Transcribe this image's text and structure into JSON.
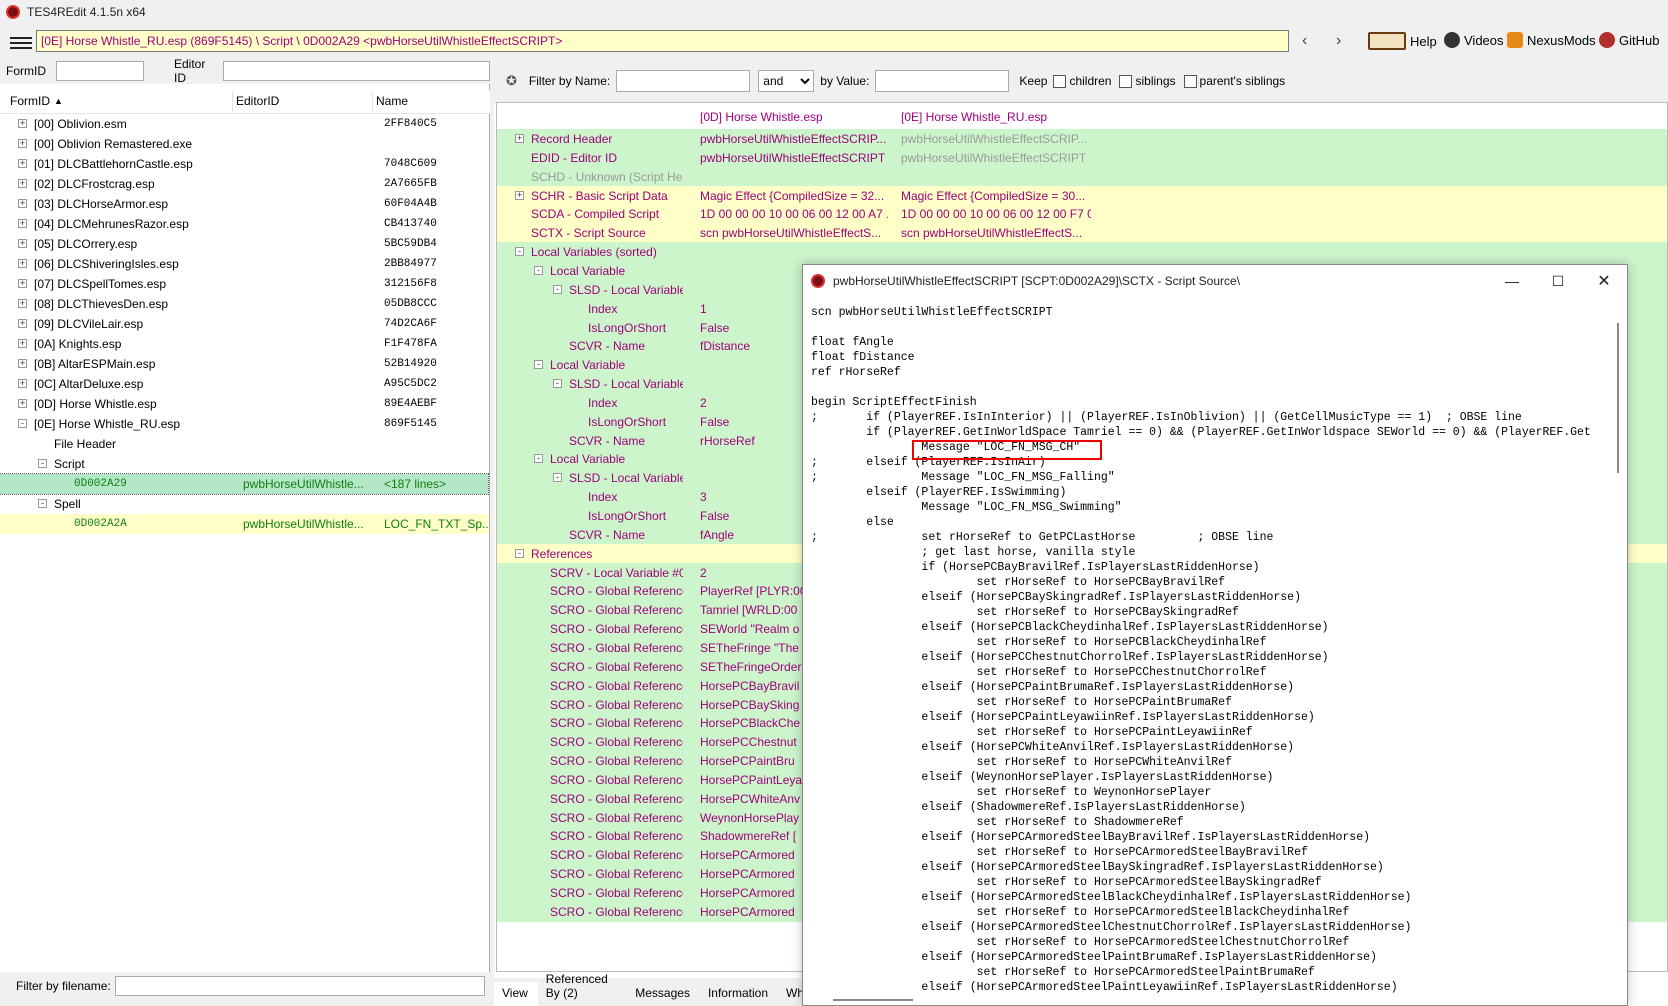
{
  "app": {
    "title": "TES4REdit 4.1.5n x64"
  },
  "path_bar": "[0E] Horse Whistle_RU.esp (869F5145) \\ Script \\ 0D002A29 <pwbHorseUtilWhistleEffectSCRIPT>",
  "top_links": [
    "Help",
    "Videos",
    "NexusMods",
    "GitHub"
  ],
  "left": {
    "formid_label": "FormID",
    "editorid_label": "Editor ID",
    "columns": [
      "FormID",
      "EditorID",
      "Name"
    ],
    "rows": [
      {
        "label": "[00] Oblivion.esm",
        "editor": "",
        "name": "2FF840C5",
        "level": 0,
        "expander": "+",
        "style": ""
      },
      {
        "label": "[00] Oblivion Remastered.exe",
        "editor": "",
        "name": "",
        "level": 0,
        "expander": "+",
        "style": ""
      },
      {
        "label": "[01] DLCBattlehornCastle.esp",
        "editor": "",
        "name": "7048C609",
        "level": 0,
        "expander": "+",
        "style": ""
      },
      {
        "label": "[02] DLCFrostcrag.esp",
        "editor": "",
        "name": "2A7665FB",
        "level": 0,
        "expander": "+",
        "style": ""
      },
      {
        "label": "[03] DLCHorseArmor.esp",
        "editor": "",
        "name": "60F04A4B",
        "level": 0,
        "expander": "+",
        "style": ""
      },
      {
        "label": "[04] DLCMehrunesRazor.esp",
        "editor": "",
        "name": "CB413740",
        "level": 0,
        "expander": "+",
        "style": ""
      },
      {
        "label": "[05] DLCOrrery.esp",
        "editor": "",
        "name": "5BC59DB4",
        "level": 0,
        "expander": "+",
        "style": ""
      },
      {
        "label": "[06] DLCShiveringIsles.esp",
        "editor": "",
        "name": "2BB84977",
        "level": 0,
        "expander": "+",
        "style": ""
      },
      {
        "label": "[07] DLCSpellTomes.esp",
        "editor": "",
        "name": "312156F8",
        "level": 0,
        "expander": "+",
        "style": ""
      },
      {
        "label": "[08] DLCThievesDen.esp",
        "editor": "",
        "name": "05DB8CCC",
        "level": 0,
        "expander": "+",
        "style": ""
      },
      {
        "label": "[09] DLCVileLair.esp",
        "editor": "",
        "name": "74D2CA6F",
        "level": 0,
        "expander": "+",
        "style": ""
      },
      {
        "label": "[0A] Knights.esp",
        "editor": "",
        "name": "F1F478FA",
        "level": 0,
        "expander": "+",
        "style": ""
      },
      {
        "label": "[0B] AltarESPMain.esp",
        "editor": "",
        "name": "52B14920",
        "level": 0,
        "expander": "+",
        "style": ""
      },
      {
        "label": "[0C] AltarDeluxe.esp",
        "editor": "",
        "name": "A95C5DC2",
        "level": 0,
        "expander": "+",
        "style": ""
      },
      {
        "label": "[0D] Horse Whistle.esp",
        "editor": "",
        "name": "89E4AEBF",
        "level": 0,
        "expander": "+",
        "style": ""
      },
      {
        "label": "[0E] Horse Whistle_RU.esp",
        "editor": "",
        "name": "869F5145",
        "level": 0,
        "expander": "-",
        "style": ""
      },
      {
        "label": "File Header",
        "editor": "",
        "name": "",
        "level": 1,
        "expander": "",
        "style": ""
      },
      {
        "label": "Script",
        "editor": "",
        "name": "",
        "level": 1,
        "expander": "-",
        "style": ""
      },
      {
        "label": "0D002A29",
        "editor": "pwbHorseUtilWhistle...",
        "name": "<187 lines>",
        "level": 2,
        "expander": "",
        "style": "selected"
      },
      {
        "label": "Spell",
        "editor": "",
        "name": "",
        "level": 1,
        "expander": "-",
        "style": ""
      },
      {
        "label": "0D002A2A",
        "editor": "pwbHorseUtilWhistle...",
        "name": "LOC_FN_TXT_Sp...",
        "level": 2,
        "expander": "",
        "style": "yellow"
      }
    ],
    "filter_label": "Filter by filename:"
  },
  "filterbar": {
    "filter_by_name": "Filter by Name:",
    "and_value": "and",
    "by_value": "by Value:",
    "keep": "Keep",
    "children": "children",
    "siblings": "siblings",
    "parents_siblings": "parent's siblings"
  },
  "grid": {
    "col_headers": [
      "[0D] Horse Whistle.esp",
      "[0E] Horse Whistle_RU.esp"
    ],
    "rows": [
      {
        "name": "Record Header",
        "v1": "pwbHorseUtilWhistleEffectSCRIP...",
        "v2": "pwbHorseUtilWhistleEffectSCRIP...",
        "indent": 0,
        "exp": "+",
        "bg": "green",
        "c1": "purple",
        "c2": "grey"
      },
      {
        "name": "EDID - Editor ID",
        "v1": "pwbHorseUtilWhistleEffectSCRIPT",
        "v2": "pwbHorseUtilWhistleEffectSCRIPT",
        "indent": 0,
        "exp": "",
        "bg": "green",
        "c1": "purple",
        "c2": "grey"
      },
      {
        "name": "SCHD - Unknown (Script He...",
        "v1": "",
        "v2": "",
        "indent": 0,
        "exp": "",
        "bg": "green",
        "c1": "grey",
        "c2": "grey"
      },
      {
        "name": "SCHR - Basic Script Data",
        "v1": "Magic Effect {CompiledSize = 32...",
        "v2": "Magic Effect {CompiledSize = 30...",
        "indent": 0,
        "exp": "+",
        "bg": "yellow",
        "c1": "purple",
        "c2": "purple"
      },
      {
        "name": "SCDA - Compiled Script",
        "v1": "1D 00 00 00 10 00 06 00 12 00 A7 ...",
        "v2": "1D 00 00 00 10 00 06 00 12 00 F7 0...",
        "indent": 0,
        "exp": "",
        "bg": "yellow",
        "c1": "purple",
        "c2": "purple"
      },
      {
        "name": "SCTX - Script Source",
        "v1": "scn pwbHorseUtilWhistleEffectS...",
        "v2": "scn pwbHorseUtilWhistleEffectS...",
        "indent": 0,
        "exp": "",
        "bg": "yellow",
        "c1": "purple",
        "c2": "purple"
      },
      {
        "name": "Local Variables (sorted)",
        "v1": "",
        "v2": "",
        "indent": 0,
        "exp": "-",
        "bg": "green",
        "c1": "purple",
        "c2": "purple"
      },
      {
        "name": "Local Variable",
        "v1": "",
        "v2": "",
        "indent": 1,
        "exp": "-",
        "bg": "green",
        "c1": "purple",
        "c2": "purple"
      },
      {
        "name": "SLSD - Local Variable ...",
        "v1": "",
        "v2": "",
        "indent": 2,
        "exp": "-",
        "bg": "green",
        "c1": "purple",
        "c2": "purple"
      },
      {
        "name": "Index",
        "v1": "1",
        "v2": "",
        "indent": 3,
        "exp": "",
        "bg": "green",
        "c1": "purple",
        "c2": "purple"
      },
      {
        "name": "IsLongOrShort",
        "v1": "False",
        "v2": "",
        "indent": 3,
        "exp": "",
        "bg": "green",
        "c1": "purple",
        "c2": "purple"
      },
      {
        "name": "SCVR - Name",
        "v1": "fDistance",
        "v2": "",
        "indent": 2,
        "exp": "",
        "bg": "green",
        "c1": "purple",
        "c2": "purple"
      },
      {
        "name": "Local Variable",
        "v1": "",
        "v2": "",
        "indent": 1,
        "exp": "-",
        "bg": "green",
        "c1": "purple",
        "c2": "purple"
      },
      {
        "name": "SLSD - Local Variable ...",
        "v1": "",
        "v2": "",
        "indent": 2,
        "exp": "-",
        "bg": "green",
        "c1": "purple",
        "c2": "purple"
      },
      {
        "name": "Index",
        "v1": "2",
        "v2": "",
        "indent": 3,
        "exp": "",
        "bg": "green",
        "c1": "purple",
        "c2": "purple"
      },
      {
        "name": "IsLongOrShort",
        "v1": "False",
        "v2": "",
        "indent": 3,
        "exp": "",
        "bg": "green",
        "c1": "purple",
        "c2": "purple"
      },
      {
        "name": "SCVR - Name",
        "v1": "rHorseRef",
        "v2": "",
        "indent": 2,
        "exp": "",
        "bg": "green",
        "c1": "purple",
        "c2": "purple"
      },
      {
        "name": "Local Variable",
        "v1": "",
        "v2": "",
        "indent": 1,
        "exp": "-",
        "bg": "green",
        "c1": "purple",
        "c2": "purple"
      },
      {
        "name": "SLSD - Local Variable ...",
        "v1": "",
        "v2": "",
        "indent": 2,
        "exp": "-",
        "bg": "green",
        "c1": "purple",
        "c2": "purple"
      },
      {
        "name": "Index",
        "v1": "3",
        "v2": "",
        "indent": 3,
        "exp": "",
        "bg": "green",
        "c1": "purple",
        "c2": "purple"
      },
      {
        "name": "IsLongOrShort",
        "v1": "False",
        "v2": "",
        "indent": 3,
        "exp": "",
        "bg": "green",
        "c1": "purple",
        "c2": "purple"
      },
      {
        "name": "SCVR - Name",
        "v1": "fAngle",
        "v2": "",
        "indent": 2,
        "exp": "",
        "bg": "green",
        "c1": "purple",
        "c2": "purple"
      },
      {
        "name": "References",
        "v1": "",
        "v2": "",
        "indent": 0,
        "exp": "-",
        "bg": "yellow",
        "c1": "purple",
        "c2": "purple"
      },
      {
        "name": "SCRV - Local Variable #0",
        "v1": "2",
        "v2": "",
        "indent": 1,
        "exp": "",
        "bg": "green",
        "c1": "purple",
        "c2": "purple"
      },
      {
        "name": "SCRO - Global Reference ...",
        "v1": "PlayerRef [PLYR:00",
        "v2": "",
        "indent": 1,
        "exp": "",
        "bg": "green",
        "c1": "purple",
        "c2": "purple"
      },
      {
        "name": "SCRO - Global Reference ...",
        "v1": "Tamriel [WRLD:00",
        "v2": "",
        "indent": 1,
        "exp": "",
        "bg": "green",
        "c1": "purple",
        "c2": "purple"
      },
      {
        "name": "SCRO - Global Reference ...",
        "v1": "SEWorld \"Realm o",
        "v2": "",
        "indent": 1,
        "exp": "",
        "bg": "green",
        "c1": "purple",
        "c2": "purple"
      },
      {
        "name": "SCRO - Global Reference ...",
        "v1": "SETheFringe \"The",
        "v2": "",
        "indent": 1,
        "exp": "",
        "bg": "green",
        "c1": "purple",
        "c2": "purple"
      },
      {
        "name": "SCRO - Global Reference ...",
        "v1": "SETheFringeOrder",
        "v2": "",
        "indent": 1,
        "exp": "",
        "bg": "green",
        "c1": "purple",
        "c2": "purple"
      },
      {
        "name": "SCRO - Global Reference ...",
        "v1": "HorsePCBayBravil",
        "v2": "",
        "indent": 1,
        "exp": "",
        "bg": "green",
        "c1": "purple",
        "c2": "purple"
      },
      {
        "name": "SCRO - Global Reference ...",
        "v1": "HorsePCBaySking",
        "v2": "",
        "indent": 1,
        "exp": "",
        "bg": "green",
        "c1": "purple",
        "c2": "purple"
      },
      {
        "name": "SCRO - Global Reference ...",
        "v1": "HorsePCBlackChe",
        "v2": "",
        "indent": 1,
        "exp": "",
        "bg": "green",
        "c1": "purple",
        "c2": "purple"
      },
      {
        "name": "SCRO - Global Reference ...",
        "v1": "HorsePCChestnut",
        "v2": "",
        "indent": 1,
        "exp": "",
        "bg": "green",
        "c1": "purple",
        "c2": "purple"
      },
      {
        "name": "SCRO - Global Reference ...",
        "v1": "HorsePCPaintBru",
        "v2": "",
        "indent": 1,
        "exp": "",
        "bg": "green",
        "c1": "purple",
        "c2": "purple"
      },
      {
        "name": "SCRO - Global Reference ...",
        "v1": "HorsePCPaintLeya",
        "v2": "",
        "indent": 1,
        "exp": "",
        "bg": "green",
        "c1": "purple",
        "c2": "purple"
      },
      {
        "name": "SCRO - Global Reference ...",
        "v1": "HorsePCWhiteAnv",
        "v2": "",
        "indent": 1,
        "exp": "",
        "bg": "green",
        "c1": "purple",
        "c2": "purple"
      },
      {
        "name": "SCRO - Global Reference ...",
        "v1": "WeynonHorsePlay",
        "v2": "",
        "indent": 1,
        "exp": "",
        "bg": "green",
        "c1": "purple",
        "c2": "purple"
      },
      {
        "name": "SCRO - Global Reference ...",
        "v1": "ShadowmereRef [",
        "v2": "",
        "indent": 1,
        "exp": "",
        "bg": "green",
        "c1": "purple",
        "c2": "purple"
      },
      {
        "name": "SCRO - Global Reference ...",
        "v1": "HorsePCArmored",
        "v2": "",
        "indent": 1,
        "exp": "",
        "bg": "green",
        "c1": "purple",
        "c2": "purple"
      },
      {
        "name": "SCRO - Global Reference ...",
        "v1": "HorsePCArmored",
        "v2": "",
        "indent": 1,
        "exp": "",
        "bg": "green",
        "c1": "purple",
        "c2": "purple"
      },
      {
        "name": "SCRO - Global Reference ...",
        "v1": "HorsePCArmored",
        "v2": "",
        "indent": 1,
        "exp": "",
        "bg": "green",
        "c1": "purple",
        "c2": "purple"
      },
      {
        "name": "SCRO - Global Reference ...",
        "v1": "HorsePCArmored",
        "v2": "",
        "indent": 1,
        "exp": "",
        "bg": "green",
        "c1": "purple",
        "c2": "purple"
      }
    ]
  },
  "bottom_tabs": [
    "View",
    "Referenced By (2)",
    "Messages",
    "Information",
    "Wh"
  ],
  "dialog": {
    "title": "pwbHorseUtilWhistleEffectSCRIPT [SCPT:0D002A29]\\SCTX - Script Source\\",
    "lines": [
      "scn pwbHorseUtilWhistleEffectSCRIPT",
      "",
      "float fAngle",
      "float fDistance",
      "ref rHorseRef",
      "",
      "begin ScriptEffectFinish",
      ";       if (PlayerREF.IsInInterior) || (PlayerREF.IsInOblivion) || (GetCellMusicType == 1)  ; OBSE line",
      "        if (PlayerREF.GetInWorldSpace Tamriel == 0) && (PlayerREF.GetInWorldspace SEWorld == 0) && (PlayerREF.Get",
      "                Message \"LOC_FN_MSG_CH\"",
      ";       elseif (PlayerREF.IsInAir)",
      ";               Message \"LOC_FN_MSG_Falling\"",
      "        elseif (PlayerREF.IsSwimming)",
      "                Message \"LOC_FN_MSG_Swimming\"",
      "        else",
      ";               set rHorseRef to GetPCLastHorse         ; OBSE line",
      "                ; get last horse, vanilla style",
      "                if (HorsePCBayBravilRef.IsPlayersLastRiddenHorse)",
      "                        set rHorseRef to HorsePCBayBravilRef",
      "                elseif (HorsePCBaySkingradRef.IsPlayersLastRiddenHorse)",
      "                        set rHorseRef to HorsePCBaySkingradRef",
      "                elseif (HorsePCBlackCheydinhalRef.IsPlayersLastRiddenHorse)",
      "                        set rHorseRef to HorsePCBlackCheydinhalRef",
      "                elseif (HorsePCChestnutChorrolRef.IsPlayersLastRiddenHorse)",
      "                        set rHorseRef to HorsePCChestnutChorrolRef",
      "                elseif (HorsePCPaintBrumaRef.IsPlayersLastRiddenHorse)",
      "                        set rHorseRef to HorsePCPaintBrumaRef",
      "                elseif (HorsePCPaintLeyawiinRef.IsPlayersLastRiddenHorse)",
      "                        set rHorseRef to HorsePCPaintLeyawiinRef",
      "                elseif (HorsePCWhiteAnvilRef.IsPlayersLastRiddenHorse)",
      "                        set rHorseRef to HorsePCWhiteAnvilRef",
      "                elseif (WeynonHorsePlayer.IsPlayersLastRiddenHorse)",
      "                        set rHorseRef to WeynonHorsePlayer",
      "                elseif (ShadowmereRef.IsPlayersLastRiddenHorse)",
      "                        set rHorseRef to ShadowmereRef",
      "                elseif (HorsePCArmoredSteelBayBravilRef.IsPlayersLastRiddenHorse)",
      "                        set rHorseRef to HorsePCArmoredSteelBayBravilRef",
      "                elseif (HorsePCArmoredSteelBaySkingradRef.IsPlayersLastRiddenHorse)",
      "                        set rHorseRef to HorsePCArmoredSteelBaySkingradRef",
      "                elseif (HorsePCArmoredSteelBlackCheydinhalRef.IsPlayersLastRiddenHorse)",
      "                        set rHorseRef to HorsePCArmoredSteelBlackCheydinhalRef",
      "                elseif (HorsePCArmoredSteelChestnutChorrolRef.IsPlayersLastRiddenHorse)",
      "                        set rHorseRef to HorsePCArmoredSteelChestnutChorrolRef",
      "                elseif (HorsePCArmoredSteelPaintBrumaRef.IsPlayersLastRiddenHorse)",
      "                        set rHorseRef to HorsePCArmoredSteelPaintBrumaRef",
      "                elseif (HorsePCArmoredSteelPaintLeyawiinRef.IsPlayersLastRiddenHorse)"
    ]
  },
  "colors": {
    "green_row": "#ccf5cc",
    "yellow_row": "#ffffc8",
    "selected_row": "#b4e6c8",
    "purple_text": "#a0007a",
    "grey_text": "#9a9a9a",
    "highlight_border": "#e00000"
  },
  "icons": [
    "hamburger-icon",
    "back-icon",
    "forward-icon",
    "book-icon",
    "videos-icon",
    "nexusmods-icon",
    "github-icon",
    "minimize-icon",
    "maximize-icon",
    "close-icon",
    "expand-icon",
    "collapse-icon",
    "sort-asc-icon",
    "pin-icon"
  ]
}
